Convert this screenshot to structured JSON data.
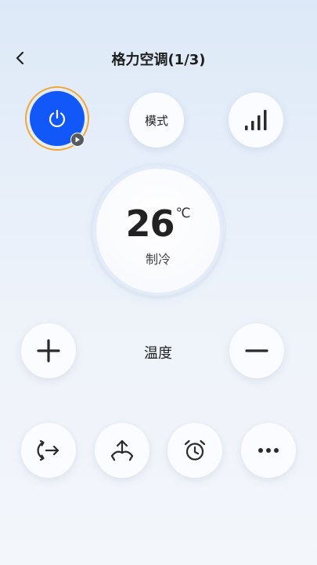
{
  "header": {
    "title": "格力空调(1/3)"
  },
  "controls": {
    "mode_label": "模式"
  },
  "display": {
    "temperature": "26",
    "unit": "℃",
    "mode": "制冷"
  },
  "temperature_control": {
    "label": "温度"
  },
  "colors": {
    "accent": "#1257f7",
    "ring": "#f0a73a"
  }
}
